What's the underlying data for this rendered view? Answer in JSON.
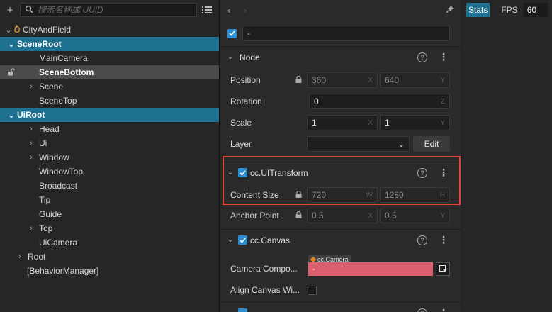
{
  "hierarchy": {
    "search_placeholder": "搜索名称或 UUID",
    "nodes": [
      {
        "label": "CityAndField"
      },
      {
        "label": "SceneRoot"
      },
      {
        "label": "MainCamera"
      },
      {
        "label": "SceneBottom"
      },
      {
        "label": "Scene"
      },
      {
        "label": "SceneTop"
      },
      {
        "label": "UiRoot"
      },
      {
        "label": "Head"
      },
      {
        "label": "Ui"
      },
      {
        "label": "Window"
      },
      {
        "label": "WindowTop"
      },
      {
        "label": "Broadcast"
      },
      {
        "label": "Tip"
      },
      {
        "label": "Guide"
      },
      {
        "label": "Top"
      },
      {
        "label": "UiCamera"
      },
      {
        "label": "Root"
      },
      {
        "label": "[BehaviorManager]"
      }
    ]
  },
  "inspector": {
    "node_name": "-",
    "node_section": {
      "title": "Node",
      "position": {
        "label": "Position",
        "x": "360",
        "y": "640"
      },
      "rotation": {
        "label": "Rotation",
        "z": "0"
      },
      "scale": {
        "label": "Scale",
        "x": "1",
        "y": "1"
      },
      "layer": {
        "label": "Layer",
        "value": "",
        "edit_label": "Edit"
      }
    },
    "uitransform": {
      "title": "cc.UITransform",
      "content_size": {
        "label": "Content Size",
        "w": "720",
        "h": "1280"
      },
      "anchor_point": {
        "label": "Anchor Point",
        "x": "0.5",
        "y": "0.5"
      }
    },
    "canvas": {
      "title": "cc.Canvas",
      "camera_component": {
        "label": "Camera Compo...",
        "tag": "cc.Camera",
        "value": "-"
      },
      "align_canvas": {
        "label": "Align Canvas Wi..."
      }
    },
    "axes": {
      "x": "X",
      "y": "Y",
      "z": "Z",
      "w": "W",
      "h": "H"
    }
  },
  "stats": {
    "tag": "Stats",
    "fps_label": "FPS",
    "fps_value": "60"
  },
  "colors": {
    "selection": "#1e7190",
    "highlight_box": "#e0463f",
    "checkbox": "#2c8ed0",
    "camera_field": "#db5f6f"
  }
}
